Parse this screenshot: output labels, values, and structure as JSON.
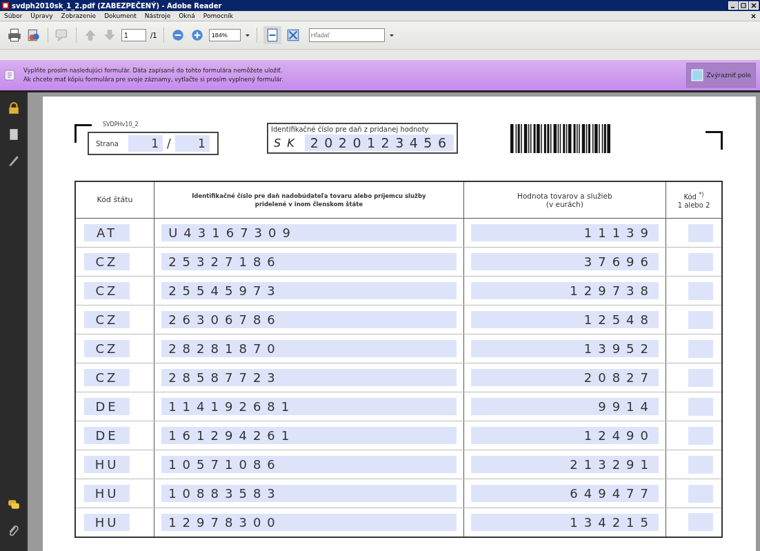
{
  "window": {
    "title": "svdph2010sk_1_2.pdf (ZABEZPEČENÝ) - Adobe Reader"
  },
  "menu": [
    "Súbor",
    "Úpravy",
    "Zobrazenie",
    "Dokument",
    "Nástroje",
    "Okná",
    "Pomocník"
  ],
  "toolbar": {
    "page": "1",
    "page_total": "/1",
    "zoom": "184%",
    "search": {
      "placeholder": "Hľadať"
    }
  },
  "form_bar": {
    "message": [
      "Vyplňte prosím nasledujúci formulár. Dáta zapísané do tohto formulára nemôžete uložiť.",
      "Ak chcete mať kópiu formulára pre svoje záznamy, vytlačte si prosím vyplnený formulár."
    ],
    "highlight_button": "Zvýrazniť pole"
  },
  "form": {
    "code": "SVDPHv10_2",
    "page_label": "Strana",
    "page": "1",
    "page_sep": "/",
    "page_total": "1",
    "tax_id_label": "Identifikačné číslo pre daň z pridanej hodnoty",
    "tax_id_prefix": "SK",
    "tax_id": "2020123456"
  },
  "table": {
    "columns": [
      "Kód štátu",
      "Identifikačné číslo pre daň nadobúdateľa tovaru alebo príjemcu služby pridelené v inom členskom štáte",
      "Hodnota tovarov a služieb\n(v eurách)",
      "Kód $^{*)}$\n1 alebo 2"
    ],
    "rows": [
      {
        "state": "AT",
        "id": "U43167309",
        "value": "11139"
      },
      {
        "state": "CZ",
        "id": "25327186",
        "value": "37696"
      },
      {
        "state": "CZ",
        "id": "25545973",
        "value": "129738"
      },
      {
        "state": "CZ",
        "id": "26306786",
        "value": "12548"
      },
      {
        "state": "CZ",
        "id": "28281870",
        "value": "13952"
      },
      {
        "state": "CZ",
        "id": "28587723",
        "value": "20827"
      },
      {
        "state": "DE",
        "id": "114192681",
        "value": "9914"
      },
      {
        "state": "DE",
        "id": "161294261",
        "value": "12490"
      },
      {
        "state": "HU",
        "id": "10571086",
        "value": "213291"
      },
      {
        "state": "HU",
        "id": "10883583",
        "value": "649477"
      },
      {
        "state": "HU",
        "id": "12978300",
        "value": "134215"
      }
    ]
  }
}
